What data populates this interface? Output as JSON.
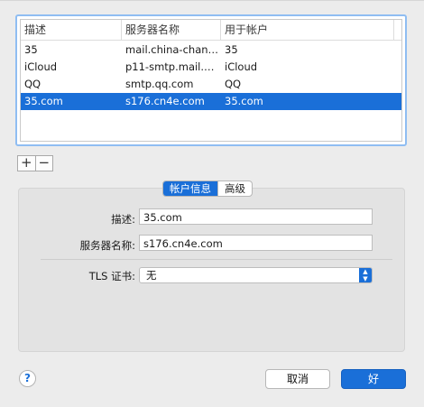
{
  "table": {
    "headers": [
      "描述",
      "服务器名称",
      "用于帐户"
    ],
    "rows": [
      {
        "description": "35",
        "server": "mail.china-chann...",
        "account": "35"
      },
      {
        "description": "iCloud",
        "server": "p11-smtp.mail.me...",
        "account": "iCloud"
      },
      {
        "description": "QQ",
        "server": "smtp.qq.com",
        "account": "QQ"
      },
      {
        "description": "35.com",
        "server": "s176.cn4e.com",
        "account": "35.com"
      }
    ],
    "selected_index": 3
  },
  "controls": {
    "add_label": "+",
    "remove_label": "−"
  },
  "tabs": [
    {
      "label": "帐户信息",
      "active": true
    },
    {
      "label": "高级",
      "active": false
    }
  ],
  "form": {
    "description_label": "描述:",
    "description_value": "35.com",
    "server_label": "服务器名称:",
    "server_value": "s176.cn4e.com",
    "tls_label": "TLS 证书:",
    "tls_value": "无"
  },
  "footer": {
    "help_label": "?",
    "cancel_label": "取消",
    "ok_label": "好"
  },
  "colors": {
    "accent": "#1a6fd8",
    "focus_ring": "#8fbdf2",
    "window_bg": "#ececec"
  }
}
